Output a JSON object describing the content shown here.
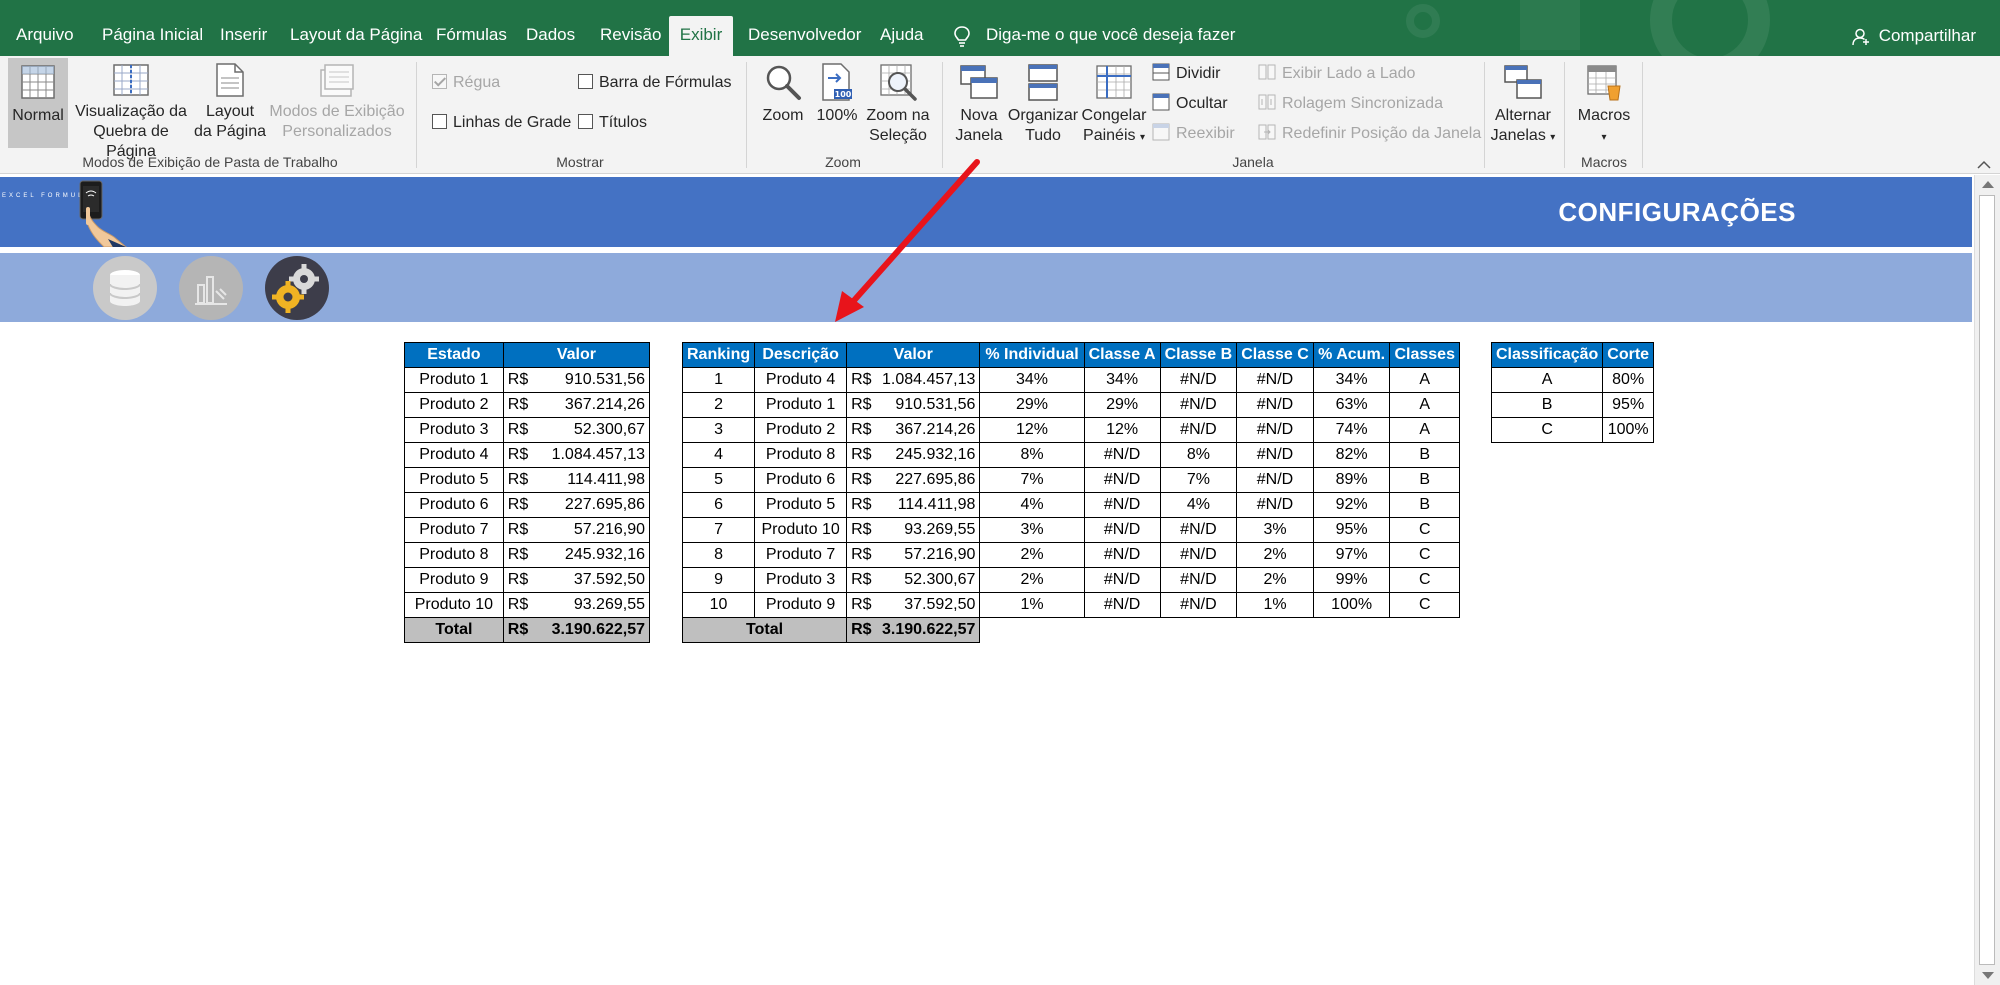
{
  "tabs": [
    {
      "label": "Arquivo"
    },
    {
      "label": "Página Inicial"
    },
    {
      "label": "Inserir"
    },
    {
      "label": "Layout da Página"
    },
    {
      "label": "Fórmulas"
    },
    {
      "label": "Dados"
    },
    {
      "label": "Revisão"
    },
    {
      "label": "Exibir",
      "active": true
    },
    {
      "label": "Desenvolvedor"
    },
    {
      "label": "Ajuda"
    }
  ],
  "tell_me": "Diga-me o que você deseja fazer",
  "share": "Compartilhar",
  "ribbon": {
    "workbook_views": {
      "normal": "Normal",
      "page_break_1": "Visualização da",
      "page_break_2": "Quebra de Página",
      "page_layout_1": "Layout",
      "page_layout_2": "da Página",
      "custom_1": "Modos de Exibição",
      "custom_2": "Personalizados",
      "group": "Modos de Exibição de Pasta de Trabalho"
    },
    "show": {
      "ruler": "Régua",
      "formula_bar": "Barra de Fórmulas",
      "gridlines": "Linhas de Grade",
      "headings": "Títulos",
      "group": "Mostrar"
    },
    "zoom": {
      "zoom": "Zoom",
      "hundred": "100%",
      "zoom_sel_1": "Zoom na",
      "zoom_sel_2": "Seleção",
      "group": "Zoom"
    },
    "window": {
      "new_1": "Nova",
      "new_2": "Janela",
      "arrange_1": "Organizar",
      "arrange_2": "Tudo",
      "freeze_1": "Congelar",
      "freeze_2": "Painéis",
      "split": "Dividir",
      "hide": "Ocultar",
      "unhide": "Reexibir",
      "side_by_side": "Exibir Lado a Lado",
      "sync_scroll": "Rolagem Sincronizada",
      "reset_pos": "Redefinir Posição da Janela",
      "switch_1": "Alternar",
      "switch_2": "Janelas",
      "group": "Janela"
    },
    "macros": {
      "macros": "Macros",
      "group": "Macros"
    }
  },
  "sheet": {
    "title": "CONFIGURAÇÕES",
    "logo_text": "EXCEL FORMULA"
  },
  "table1": {
    "headers": [
      "Estado",
      "Valor"
    ],
    "rows": [
      [
        "Produto 1",
        "R$",
        "910.531,56"
      ],
      [
        "Produto 2",
        "R$",
        "367.214,26"
      ],
      [
        "Produto 3",
        "R$",
        "52.300,67"
      ],
      [
        "Produto 4",
        "R$",
        "1.084.457,13"
      ],
      [
        "Produto 5",
        "R$",
        "114.411,98"
      ],
      [
        "Produto 6",
        "R$",
        "227.695,86"
      ],
      [
        "Produto 7",
        "R$",
        "57.216,90"
      ],
      [
        "Produto 8",
        "R$",
        "245.932,16"
      ],
      [
        "Produto 9",
        "R$",
        "37.592,50"
      ],
      [
        "Produto 10",
        "R$",
        "93.269,55"
      ]
    ],
    "total_label": "Total",
    "total_cur": "R$",
    "total_value": "3.190.622,57"
  },
  "table2": {
    "headers": [
      "Ranking",
      "Descrição",
      "Valor",
      "% Individual",
      "Classe A",
      "Classe B",
      "Classe C",
      "% Acum.",
      "Classes"
    ],
    "rows": [
      [
        "1",
        "Produto 4",
        "R$",
        "1.084.457,13",
        "34%",
        "34%",
        "#N/D",
        "#N/D",
        "34%",
        "A"
      ],
      [
        "2",
        "Produto 1",
        "R$",
        "910.531,56",
        "29%",
        "29%",
        "#N/D",
        "#N/D",
        "63%",
        "A"
      ],
      [
        "3",
        "Produto 2",
        "R$",
        "367.214,26",
        "12%",
        "12%",
        "#N/D",
        "#N/D",
        "74%",
        "A"
      ],
      [
        "4",
        "Produto 8",
        "R$",
        "245.932,16",
        "8%",
        "#N/D",
        "8%",
        "#N/D",
        "82%",
        "B"
      ],
      [
        "5",
        "Produto 6",
        "R$",
        "227.695,86",
        "7%",
        "#N/D",
        "7%",
        "#N/D",
        "89%",
        "B"
      ],
      [
        "6",
        "Produto 5",
        "R$",
        "114.411,98",
        "4%",
        "#N/D",
        "4%",
        "#N/D",
        "92%",
        "B"
      ],
      [
        "7",
        "Produto 10",
        "R$",
        "93.269,55",
        "3%",
        "#N/D",
        "#N/D",
        "3%",
        "95%",
        "C"
      ],
      [
        "8",
        "Produto 7",
        "R$",
        "57.216,90",
        "2%",
        "#N/D",
        "#N/D",
        "2%",
        "97%",
        "C"
      ],
      [
        "9",
        "Produto 3",
        "R$",
        "52.300,67",
        "2%",
        "#N/D",
        "#N/D",
        "2%",
        "99%",
        "C"
      ],
      [
        "10",
        "Produto 9",
        "R$",
        "37.592,50",
        "1%",
        "#N/D",
        "#N/D",
        "1%",
        "100%",
        "C"
      ]
    ],
    "total_label": "Total",
    "total_cur": "R$",
    "total_value": "3.190.622,57"
  },
  "table3": {
    "headers": [
      "Classificação",
      "Corte"
    ],
    "rows": [
      [
        "A",
        "80%"
      ],
      [
        "B",
        "95%"
      ],
      [
        "C",
        "100%"
      ]
    ]
  },
  "colors": {
    "excel_green": "#217346",
    "header_blue": "#0070c0",
    "banner_blue": "#4472c4",
    "banner_light": "#8eaadb",
    "arrow_red": "#e8141b"
  }
}
